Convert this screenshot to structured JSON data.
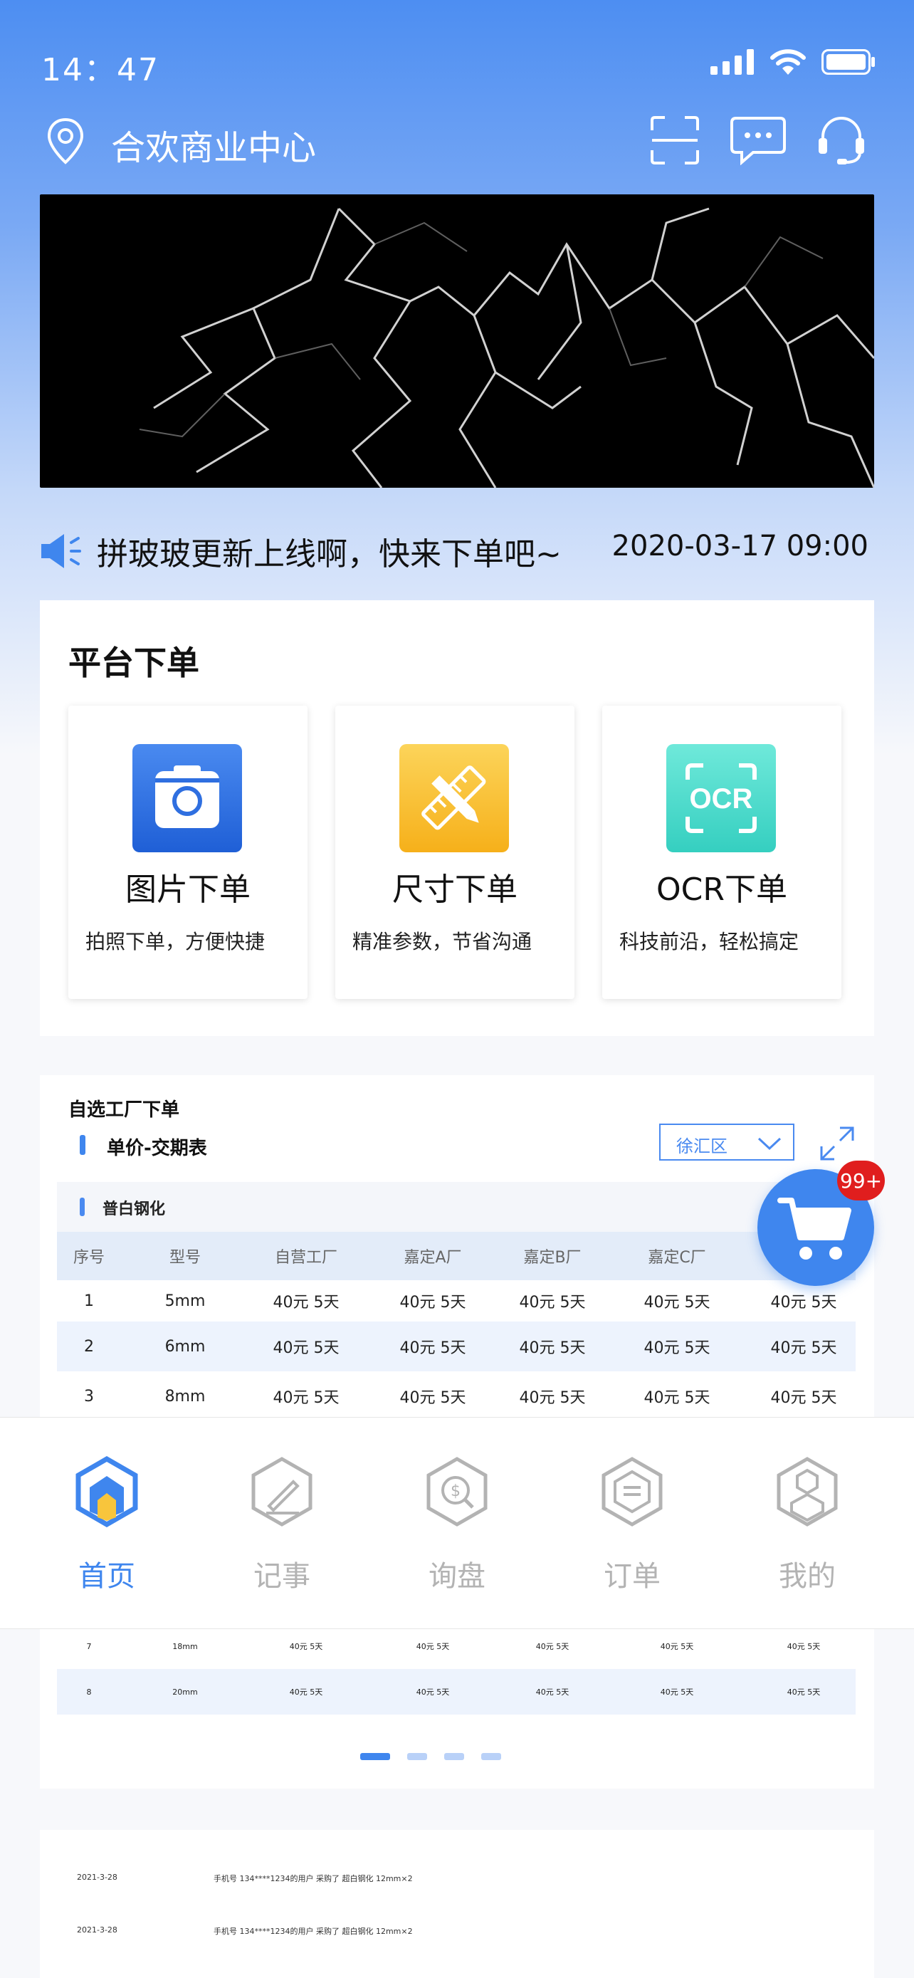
{
  "status_bar": {
    "time": "14：47"
  },
  "header": {
    "location": "合欢商业中心"
  },
  "notice": {
    "text": "拼玻玻更新上线啊，快来下单吧~",
    "time": "2020-03-17 09:00"
  },
  "platform": {
    "title": "平台下单",
    "tiles": [
      {
        "title": "图片下单",
        "desc": "拍照下单，方便快捷",
        "icon": "camera-icon",
        "color": "#2f6fe0"
      },
      {
        "title": "尺寸下单",
        "desc": "精准参数，节省沟通",
        "icon": "ruler-pencil-icon",
        "color": "#f7b51f"
      },
      {
        "title": "OCR下单",
        "desc": "科技前沿，轻松搞定",
        "icon": "ocr-scan-icon",
        "icon_text": "OCR",
        "color": "#45d8c8"
      }
    ]
  },
  "factory": {
    "title": "自选工厂下单",
    "subtitle": "单价-交期表",
    "district": "徐汇区",
    "section": "普白钢化",
    "columns": [
      "序号",
      "型号",
      "自营工厂",
      "嘉定A厂",
      "嘉定B厂",
      "嘉定C厂"
    ],
    "rows": [
      [
        "1",
        "5mm",
        "40元 5天",
        "40元 5天",
        "40元 5天",
        "40元 5天",
        "40元 5天"
      ],
      [
        "2",
        "6mm",
        "40元 5天",
        "40元 5天",
        "40元 5天",
        "40元 5天",
        "40元 5天"
      ],
      [
        "3",
        "8mm",
        "40元 5天",
        "40元 5天",
        "40元 5天",
        "40元 5天",
        "40元 5天"
      ]
    ],
    "rows_small": [
      [
        "7",
        "18mm",
        "40元 5天",
        "40元 5天",
        "40元 5天",
        "40元 5天",
        "40元 5天"
      ],
      [
        "8",
        "20mm",
        "40元 5天",
        "40元 5天",
        "40元 5天",
        "40元 5天",
        "40元 5天"
      ]
    ],
    "pages": 4,
    "current_page": 1
  },
  "cart": {
    "badge": "99+"
  },
  "tabs": [
    {
      "label": "首页",
      "icon": "home-hex-icon",
      "active": true
    },
    {
      "label": "记事",
      "icon": "note-hex-icon",
      "active": false
    },
    {
      "label": "询盘",
      "icon": "inquiry-hex-icon",
      "active": false
    },
    {
      "label": "订单",
      "icon": "order-hex-icon",
      "active": false
    },
    {
      "label": "我的",
      "icon": "profile-hex-icon",
      "active": false
    }
  ],
  "news": [
    {
      "date": "2021-3-28",
      "text": "手机号 134****1234的用户 采购了 超白钢化 12mm×2"
    },
    {
      "date": "2021-3-28",
      "text": "手机号 134****1234的用户 采购了 超白钢化 12mm×2"
    }
  ],
  "colors": {
    "primary": "#3f86ee",
    "badge": "#e01e1e"
  }
}
